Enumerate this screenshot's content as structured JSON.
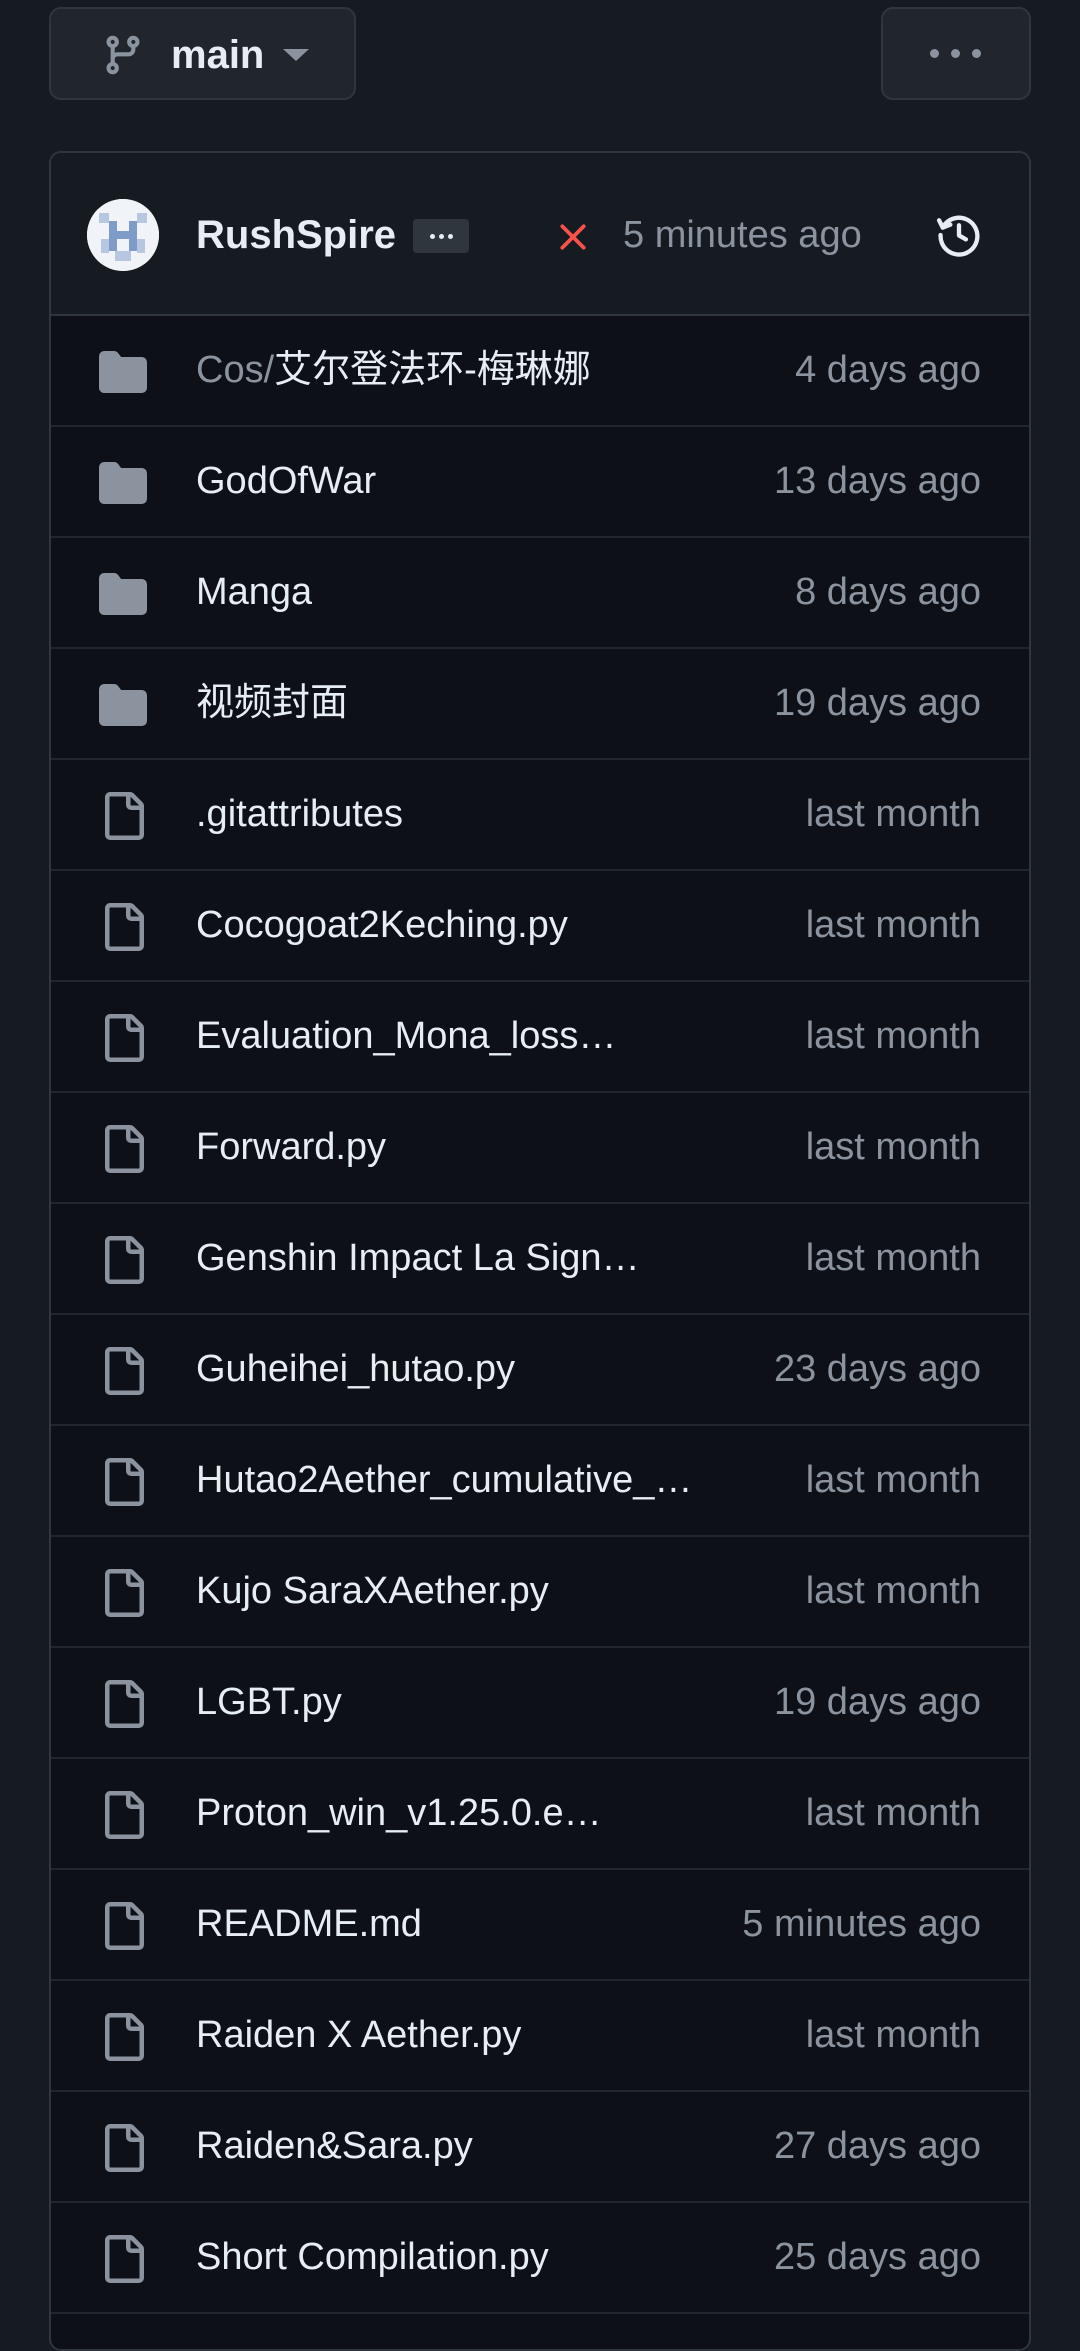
{
  "branch": {
    "name": "main"
  },
  "commit": {
    "author": "RushSpire",
    "status": "failed",
    "time": "5 minutes ago"
  },
  "files": [
    {
      "type": "folder",
      "prefix": "Cos/",
      "name": "艾尔登法环-梅琳娜",
      "date": "4 days ago"
    },
    {
      "type": "folder",
      "prefix": "",
      "name": "GodOfWar",
      "date": "13 days ago"
    },
    {
      "type": "folder",
      "prefix": "",
      "name": "Manga",
      "date": "8 days ago"
    },
    {
      "type": "folder",
      "prefix": "",
      "name": "视频封面",
      "date": "19 days ago"
    },
    {
      "type": "file",
      "prefix": "",
      "name": ".gitattributes",
      "date": "last month"
    },
    {
      "type": "file",
      "prefix": "",
      "name": "Cocogoat2Keching.py",
      "date": "last month"
    },
    {
      "type": "file",
      "prefix": "",
      "name": "Evaluation_Mona_loss…",
      "date": "last month"
    },
    {
      "type": "file",
      "prefix": "",
      "name": "Forward.py",
      "date": "last month"
    },
    {
      "type": "file",
      "prefix": "",
      "name": "Genshin Impact La Sign…",
      "date": "last month"
    },
    {
      "type": "file",
      "prefix": "",
      "name": "Guheihei_hutao.py",
      "date": "23 days ago"
    },
    {
      "type": "file",
      "prefix": "",
      "name": "Hutao2Aether_cumulative_…",
      "date": "last month"
    },
    {
      "type": "file",
      "prefix": "",
      "name": "Kujo SaraXAether.py",
      "date": "last month"
    },
    {
      "type": "file",
      "prefix": "",
      "name": "LGBT.py",
      "date": "19 days ago"
    },
    {
      "type": "file",
      "prefix": "",
      "name": "Proton_win_v1.25.0.e…",
      "date": "last month"
    },
    {
      "type": "file",
      "prefix": "",
      "name": "README.md",
      "date": "5 minutes ago"
    },
    {
      "type": "file",
      "prefix": "",
      "name": "Raiden X Aether.py",
      "date": "last month"
    },
    {
      "type": "file",
      "prefix": "",
      "name": "Raiden&Sara.py",
      "date": "27 days ago"
    },
    {
      "type": "file",
      "prefix": "",
      "name": "Short Compilation.py",
      "date": "25 days ago"
    },
    {
      "type": "file",
      "prefix": "",
      "name": "",
      "date": ""
    }
  ],
  "colors": {
    "background": "#161b22",
    "panel": "#0d1117",
    "border": "#30363d",
    "text": "#e6edf3",
    "muted": "#8b949e",
    "fail": "#f85149"
  }
}
